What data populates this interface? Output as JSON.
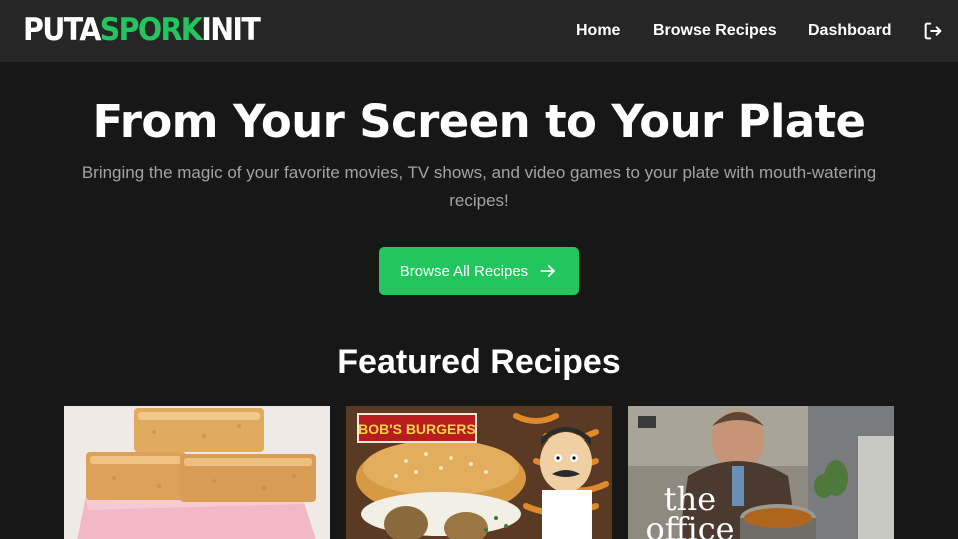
{
  "logo": {
    "part1": "PUTA",
    "part2": "SPORK",
    "part3": "INIT"
  },
  "nav": {
    "home": "Home",
    "browse": "Browse Recipes",
    "dashboard": "Dashboard",
    "logout_icon": "logout-icon"
  },
  "hero": {
    "title": "From Your Screen to Your Plate",
    "subtitle": "Bringing the magic of your favorite movies, TV shows, and video games to your plate with mouth-watering recipes!",
    "cta_label": "Browse All Recipes",
    "cta_icon": "arrow-right-icon"
  },
  "featured": {
    "title": "Featured Recipes",
    "cards": [
      {
        "image_text": ""
      },
      {
        "image_text": "BOB'S BURGERS"
      },
      {
        "image_text": "the office"
      }
    ]
  },
  "colors": {
    "accent": "#22c55e",
    "background": "#171717",
    "navbar": "#262626",
    "muted_text": "#a3a3a3"
  }
}
